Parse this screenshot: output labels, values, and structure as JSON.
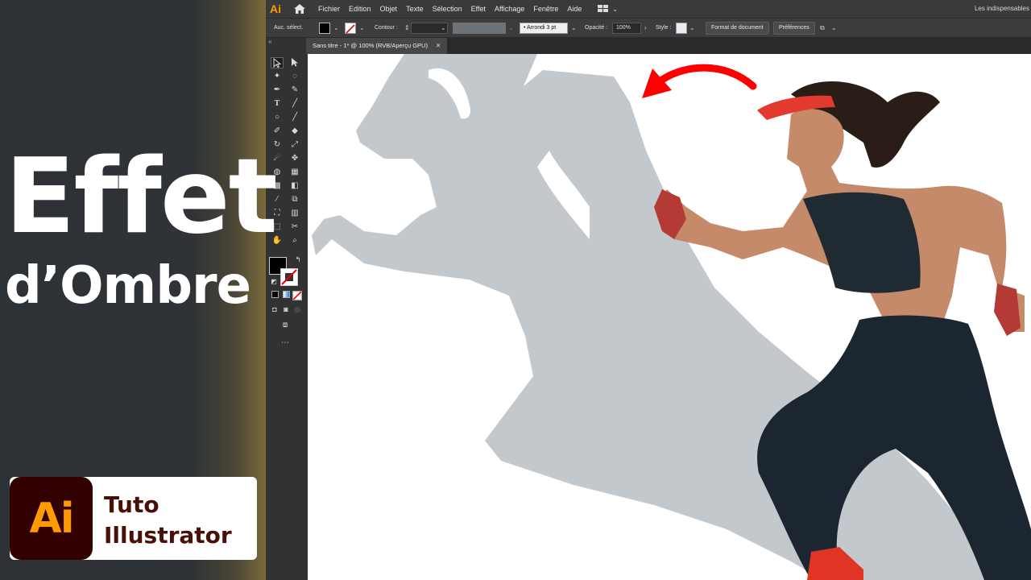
{
  "thumbnail": {
    "title_line1": "Effet",
    "title_line2": "d’Ombre",
    "badge": {
      "logo_text": "Ai",
      "line1": "Tuto",
      "line2": "Illustrator"
    }
  },
  "app": {
    "logo": "Ai",
    "menu": [
      "Fichier",
      "Edition",
      "Objet",
      "Texte",
      "Sélection",
      "Effet",
      "Affichage",
      "Fenêtre",
      "Aide"
    ],
    "workspace": "Les indispensables"
  },
  "control_bar": {
    "selection_label": "Auc. sélect.",
    "stroke_label": "Contour :",
    "brush_value": "Arrondi 3 pt",
    "opacity_label": "Opacité :",
    "opacity_value": "100%",
    "style_label": "Style :",
    "doc_format_button": "Format de document",
    "prefs_button": "Préférences"
  },
  "document": {
    "tab_title": "Sans titre - 1* @ 100% (RVB/Aperçu GPU)",
    "tab_close": "✕"
  },
  "colors": {
    "accent_orange": "#ff9a00",
    "ai_logo_bg": "#330000",
    "shadow": "#c2c8cc",
    "arrow": "#ff0000"
  },
  "icons": [
    "home-icon",
    "workspace-grid-icon",
    "selection-tool-icon",
    "direct-selection-icon",
    "magic-wand-icon",
    "lasso-icon",
    "pen-icon",
    "curvature-icon",
    "type-icon",
    "line-icon",
    "ellipse-icon",
    "paintbrush-icon",
    "shaper-icon",
    "eraser-icon",
    "rotate-icon",
    "scale-icon",
    "warp-icon",
    "free-transform-icon",
    "shape-builder-icon",
    "perspective-icon",
    "mesh-icon",
    "gradient-icon",
    "eyedropper-icon",
    "blend-icon",
    "symbol-sprayer-icon",
    "graph-icon",
    "artboard-icon",
    "slice-icon",
    "hand-icon",
    "zoom-icon"
  ]
}
